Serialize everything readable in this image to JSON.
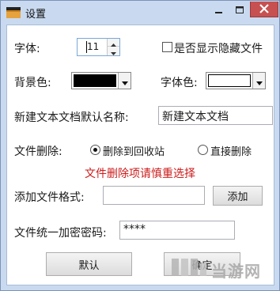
{
  "window": {
    "title": "设置",
    "accent": "#c9daf0",
    "close_color": "#c75050"
  },
  "font": {
    "label": "字体:",
    "size_value": "11"
  },
  "show_hidden": {
    "label": "是否显示隐藏文件",
    "checked": false
  },
  "background_color": {
    "label": "背景色:",
    "value": "#000000"
  },
  "font_color": {
    "label": "字体色:",
    "value": "#ffffff"
  },
  "default_name": {
    "label": "新建文本文档默认名称:",
    "value": "新建文本文档"
  },
  "file_delete": {
    "label": "文件删除:",
    "options": [
      {
        "label": "删除到回收站",
        "selected": true
      },
      {
        "label": "直接删除",
        "selected": false
      }
    ],
    "warning": "文件删除项请慎重选择"
  },
  "add_format": {
    "label": "添加文件格式:",
    "value": "",
    "button_label": "添加"
  },
  "password": {
    "label": "文件统一加密密码:",
    "value": "****"
  },
  "buttons": {
    "default_label": "默认",
    "ok_label": "确定"
  },
  "watermark": {
    "text": "当游网"
  },
  "icons": {
    "app": "folder-icon",
    "minimize": "minimize-icon",
    "maximize": "maximize-icon",
    "close": "close-icon",
    "spin_up": "chevron-up-icon",
    "spin_down": "chevron-down-icon"
  }
}
